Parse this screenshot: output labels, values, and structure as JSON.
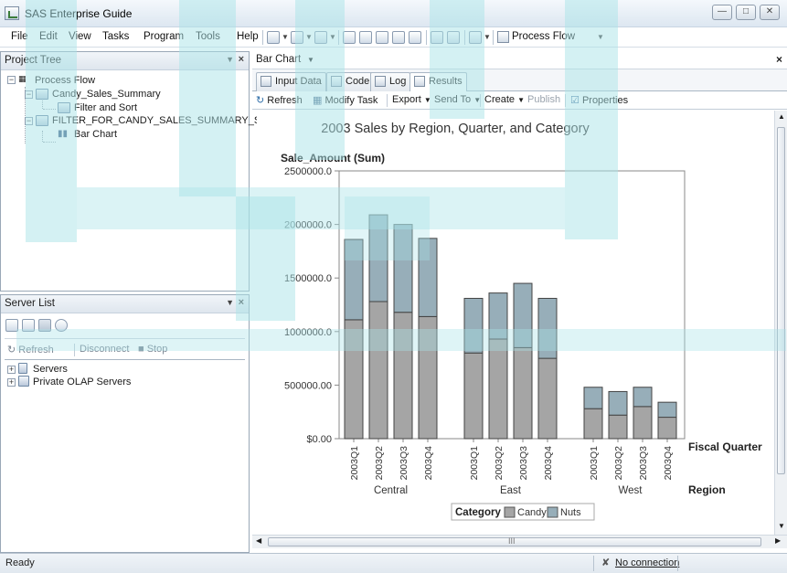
{
  "window": {
    "title": "SAS Enterprise Guide"
  },
  "menu": {
    "items": [
      "File",
      "Edit",
      "View",
      "Tasks",
      "Program",
      "Tools",
      "Help"
    ],
    "process_flow_label": "Process Flow"
  },
  "project_tree": {
    "title": "Project Tree",
    "nodes": {
      "process_flow": "Process Flow",
      "candy_sales_summary": "Candy_Sales_Summary",
      "filter_and_sort": "Filter and Sort",
      "filter_table": "FILTER_FOR_CANDY_SALES_SUMMARY_S",
      "bar_chart": "Bar Chart"
    }
  },
  "server_list": {
    "title": "Server List",
    "refresh_label": "Refresh",
    "disconnect_label": "Disconnect",
    "stop_label": "Stop",
    "nodes": [
      "Servers",
      "Private OLAP Servers"
    ]
  },
  "document": {
    "title": "Bar Chart",
    "tabs": [
      "Input Data",
      "Code",
      "Log",
      "Results"
    ],
    "active_tab": "Results",
    "actions": {
      "refresh": "Refresh",
      "modify_task": "Modify Task",
      "export": "Export",
      "send_to": "Send To",
      "create": "Create",
      "publish": "Publish",
      "properties": "Properties"
    },
    "hscroll_grip": "III"
  },
  "status": {
    "left": "Ready",
    "connection": "No connection"
  },
  "colors": {
    "candy": "#a5a5a5",
    "nuts": "#97aeb9",
    "watermark": "#a9e3e8"
  },
  "chart_data": {
    "type": "bar",
    "stacked": true,
    "title": "2003 Sales by Region, Quarter, and Category",
    "ylabel": "Sale_Amount (Sum)",
    "xlabel": "Fiscal Quarter",
    "group_label": "Region",
    "ylim": [
      0,
      2500000
    ],
    "yticks": [
      0,
      500000,
      1000000,
      1500000,
      2000000,
      2500000
    ],
    "ytick_labels": [
      "$0.00",
      "500000.00",
      "1000000.0",
      "1500000.0",
      "2000000.0",
      "2500000.0"
    ],
    "groups": [
      "Central",
      "East",
      "West"
    ],
    "categories": [
      "2003Q1",
      "2003Q2",
      "2003Q3",
      "2003Q4",
      "2003Q1",
      "2003Q2",
      "2003Q3",
      "2003Q4",
      "2003Q1",
      "2003Q2",
      "2003Q3",
      "2003Q4"
    ],
    "legend_title": "Category",
    "legend_position": "bottom",
    "series": [
      {
        "name": "Candy",
        "values": [
          1110000,
          1280000,
          1180000,
          1140000,
          800000,
          930000,
          850000,
          750000,
          280000,
          220000,
          300000,
          200000
        ]
      },
      {
        "name": "Nuts",
        "values": [
          750000,
          810000,
          820000,
          730000,
          510000,
          430000,
          600000,
          560000,
          200000,
          220000,
          180000,
          140000
        ]
      }
    ]
  }
}
